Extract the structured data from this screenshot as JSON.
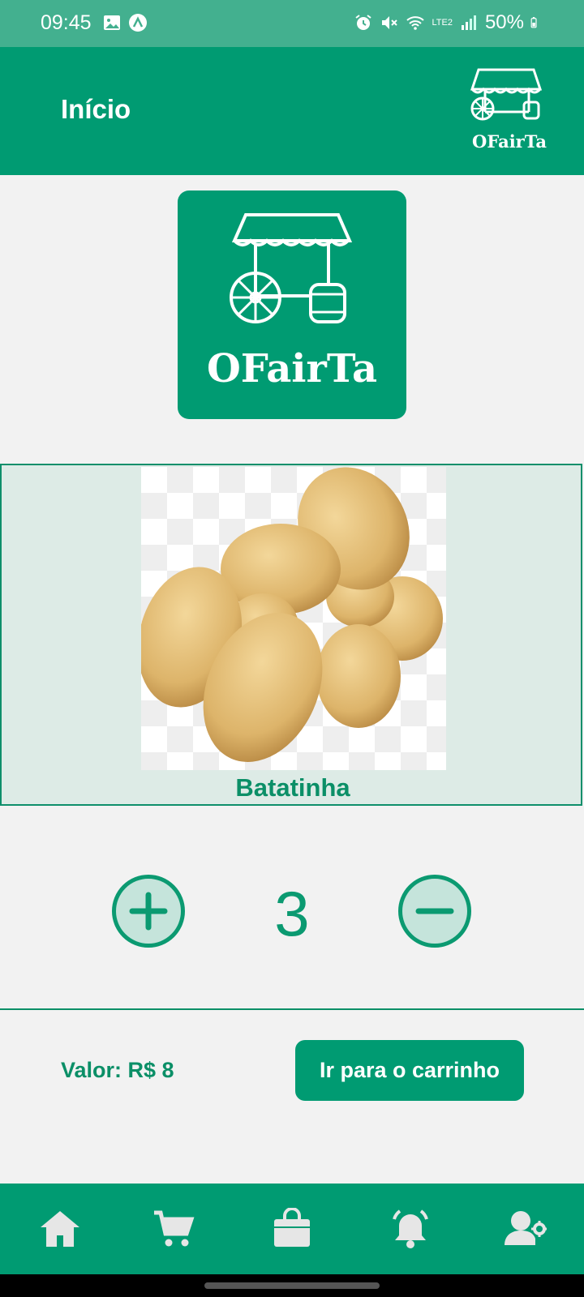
{
  "status_bar": {
    "time": "09:45",
    "battery": "50%",
    "network": "LTE2"
  },
  "header": {
    "title": "Início",
    "logo_text": "OFairTa"
  },
  "brand": {
    "logo_text": "OFairTa"
  },
  "product": {
    "name": "Batatinha",
    "image": "potatoes-image"
  },
  "quantity": {
    "value": "3"
  },
  "footer": {
    "price_label": "Valor: R$ 8",
    "cart_button_label": "Ir para o carrinho"
  },
  "nav": {
    "items": [
      {
        "icon": "home-icon"
      },
      {
        "icon": "cart-icon"
      },
      {
        "icon": "shopping-bag-icon"
      },
      {
        "icon": "bell-icon"
      },
      {
        "icon": "user-settings-icon"
      }
    ]
  },
  "colors": {
    "primary": "#009b72",
    "card_bg": "#ddebe6",
    "background": "#f2f2f2"
  }
}
